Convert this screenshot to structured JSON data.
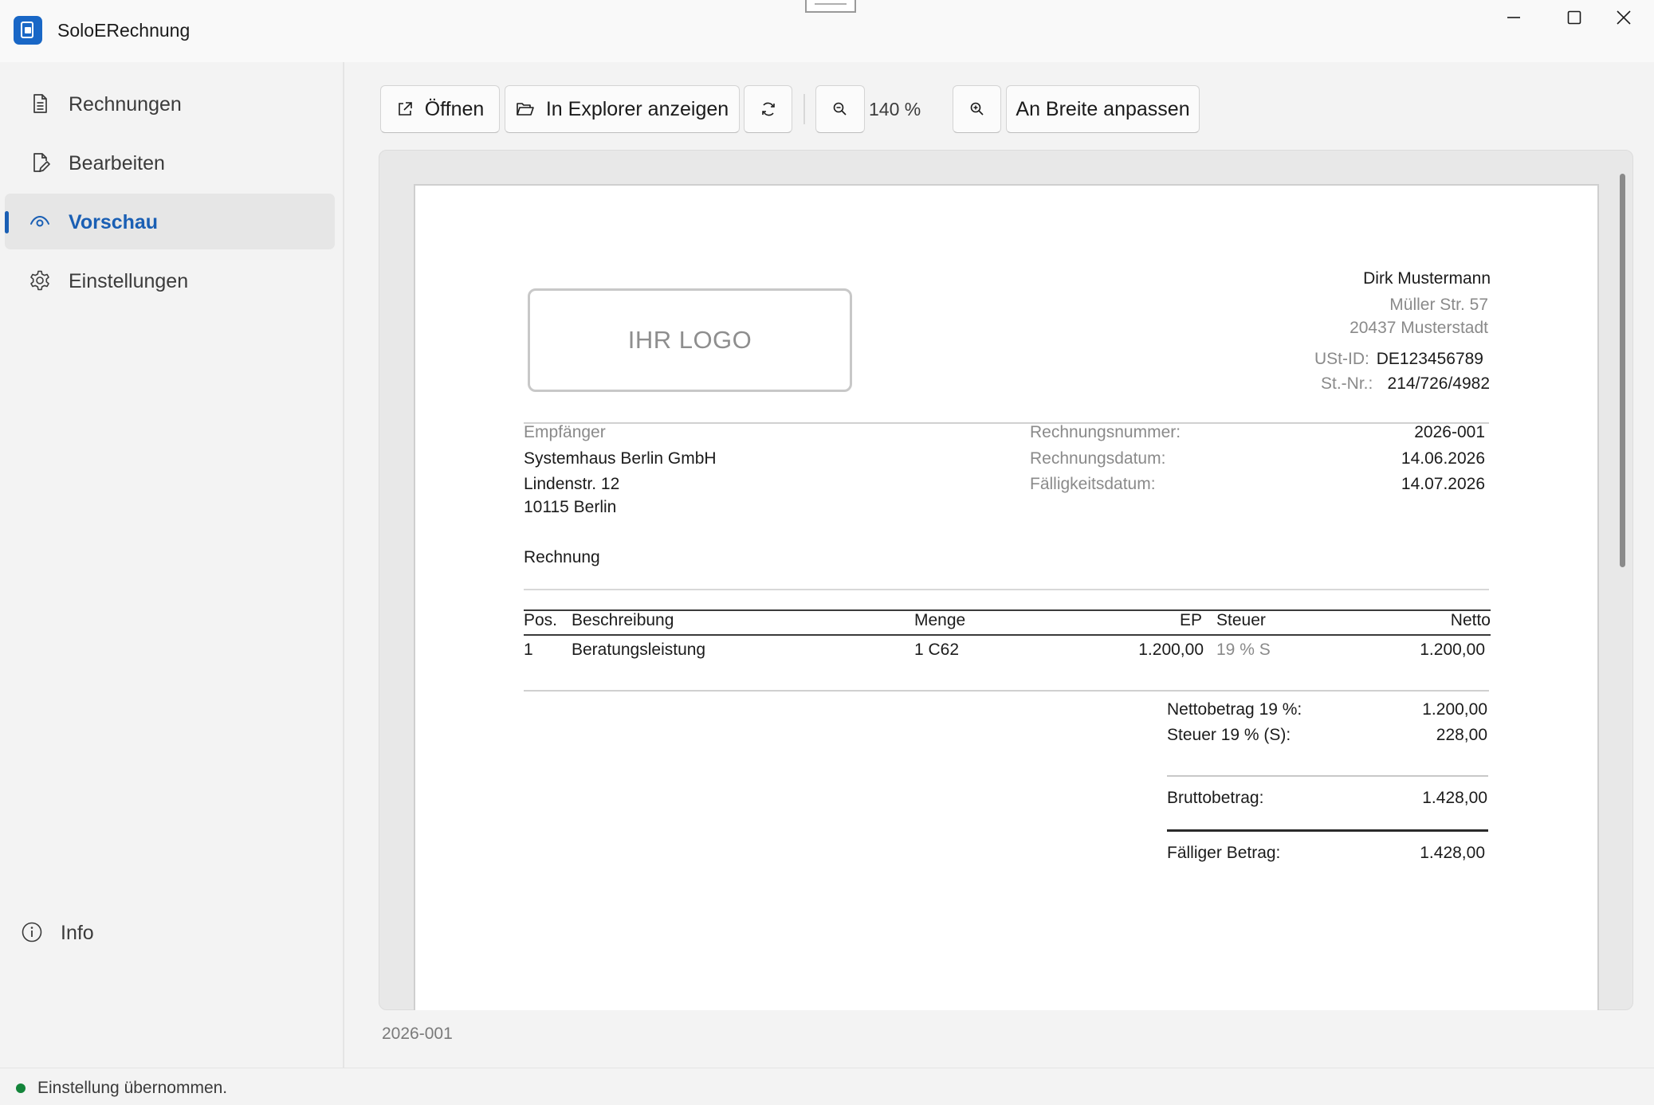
{
  "app": {
    "title": "SoloERechnung"
  },
  "sidebar": {
    "items": [
      {
        "label": "Rechnungen",
        "icon": "document-list-icon",
        "active": false
      },
      {
        "label": "Bearbeiten",
        "icon": "document-edit-icon",
        "active": false
      },
      {
        "label": "Vorschau",
        "icon": "eye-icon",
        "active": true
      },
      {
        "label": "Einstellungen",
        "icon": "gear-icon",
        "active": false
      }
    ],
    "info_label": "Info"
  },
  "toolbar": {
    "open_label": "Öffnen",
    "explorer_label": "In Explorer anzeigen",
    "zoom_level": "140 %",
    "fit_width_label": "An Breite anpassen"
  },
  "invoice": {
    "logo_placeholder": "IHR LOGO",
    "sender": {
      "name": "Dirk Mustermann",
      "street": "Müller Str. 57",
      "city": "20437 Musterstadt",
      "vat_label": "USt-ID:",
      "vat_value": "DE123456789",
      "tax_label": "St.-Nr.:",
      "tax_value": "214/726/4982"
    },
    "recipient": {
      "label": "Empfänger",
      "name": "Systemhaus Berlin GmbH",
      "street": "Lindenstr. 12",
      "city": "10115 Berlin"
    },
    "meta": {
      "number_label": "Rechnungsnummer:",
      "number_value": "2026-001",
      "date_label": "Rechnungsdatum:",
      "date_value": "14.06.2026",
      "due_label": "Fälligkeitsdatum:",
      "due_value": "14.07.2026"
    },
    "doc_title": "Rechnung",
    "table": {
      "headers": {
        "pos": "Pos.",
        "desc": "Beschreibung",
        "qty": "Menge",
        "ep": "EP",
        "tax": "Steuer",
        "net": "Netto"
      },
      "rows": [
        {
          "pos": "1",
          "desc": "Beratungsleistung",
          "qty": "1 C62",
          "ep": "1.200,00",
          "tax": "19 % S",
          "net": "1.200,00"
        }
      ]
    },
    "totals": {
      "net_label": "Nettobetrag 19 %:",
      "net_value": "1.200,00",
      "tax_label": "Steuer 19 % (S):",
      "tax_value": "228,00",
      "gross_label": "Bruttobetrag:",
      "gross_value": "1.428,00",
      "due_label": "Fälliger Betrag:",
      "due_value": "1.428,00"
    }
  },
  "footer": {
    "filename": "2026-001"
  },
  "status": {
    "text": "Einstellung übernommen.",
    "color": "#13843a"
  },
  "colors": {
    "accent": "#1a5fb4",
    "app_icon": "#1967c6"
  }
}
